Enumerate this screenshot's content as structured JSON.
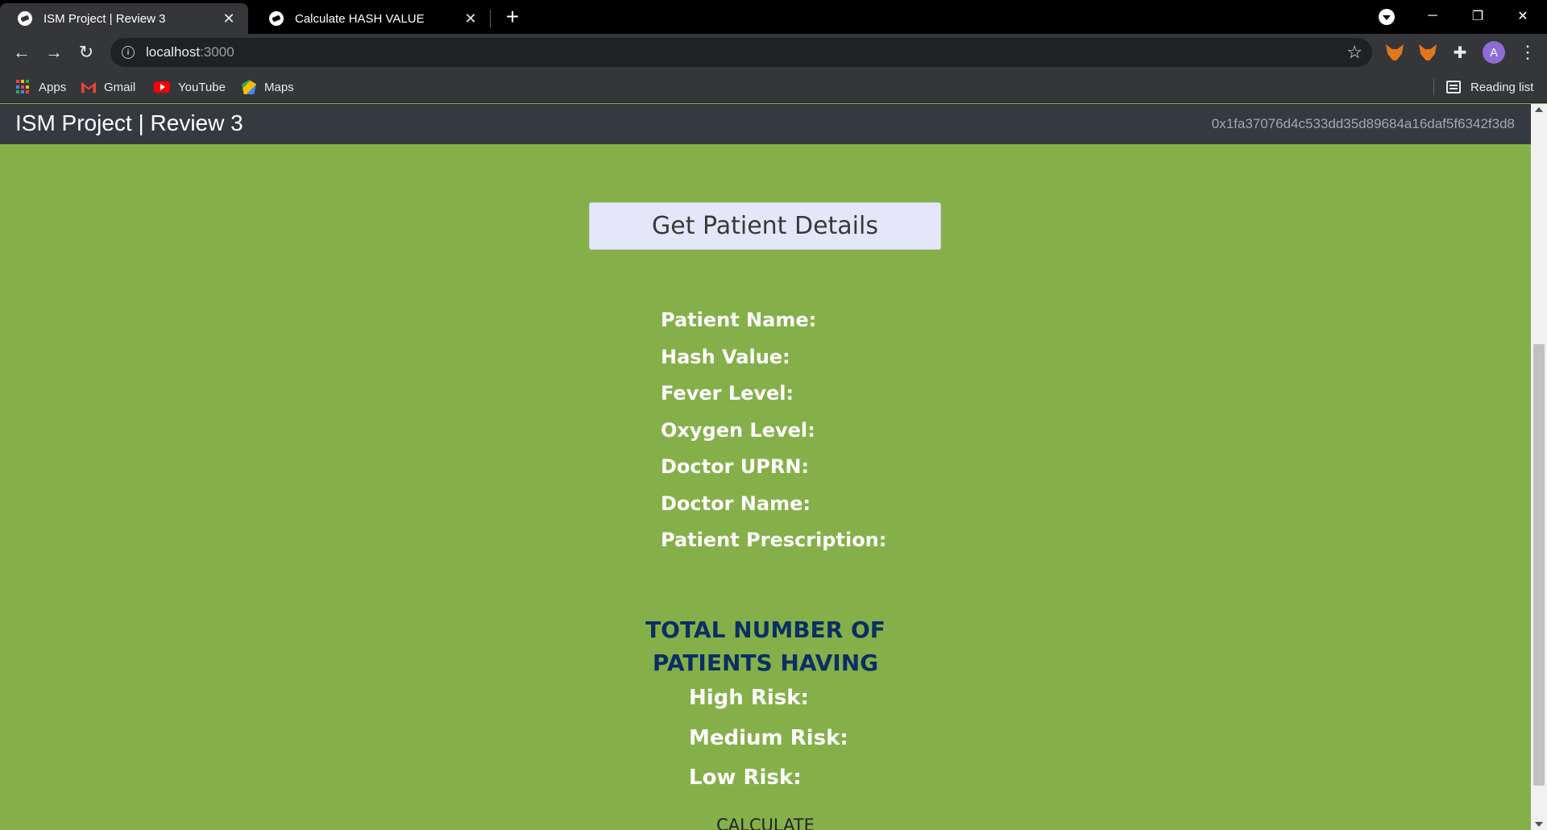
{
  "browser": {
    "tabs": [
      {
        "title": "ISM Project | Review 3",
        "active": true
      },
      {
        "title": "Calculate HASH VALUE",
        "active": false
      }
    ],
    "url_host": "localhost",
    "url_port": ":3000",
    "bookmarks": [
      {
        "label": "Apps",
        "icon": "apps-grid-icon"
      },
      {
        "label": "Gmail",
        "icon": "gmail-icon"
      },
      {
        "label": "YouTube",
        "icon": "youtube-icon"
      },
      {
        "label": "Maps",
        "icon": "maps-icon"
      }
    ],
    "reading_list": "Reading list",
    "profile_initial": "A"
  },
  "app": {
    "title": "ISM Project | Review 3",
    "account": "0x1fa37076d4c533dd35d89684a16daf5f6342f3d8"
  },
  "main": {
    "get_button": "Get Patient Details",
    "fields": [
      "Patient Name:",
      "Hash Value:",
      "Fever Level:",
      "Oxygen Level:",
      "Doctor UPRN:",
      "Doctor Name:",
      "Patient Prescription:"
    ],
    "totals_heading_line1": "TOTAL NUMBER OF",
    "totals_heading_line2": "PATIENTS HAVING",
    "risks": [
      "High Risk:",
      "Medium Risk:",
      "Low Risk:"
    ],
    "calculate_button": "CALCULATE"
  },
  "colors": {
    "page_background": "#85b049",
    "navbar": "#343a40",
    "heading": "#0b2f63",
    "button": "#e6e6fa"
  }
}
